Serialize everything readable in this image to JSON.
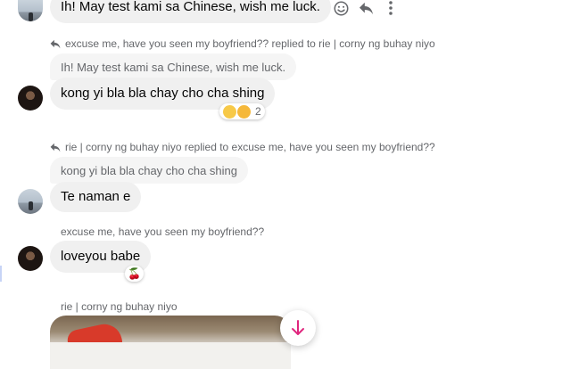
{
  "messages": {
    "m1": {
      "text": "Ih! May test kami sa Chinese, wish me luck."
    },
    "m2": {
      "reply_header": "excuse me, have you seen my boyfriend?? replied to rie | corny ng buhay niyo",
      "quoted": "Ih! May test kami sa Chinese, wish me luck.",
      "text": "kong yi bla bla chay cho cha shing",
      "reaction_count": "2"
    },
    "m3": {
      "reply_header": "rie | corny ng buhay niyo replied to excuse me, have you seen my boyfriend??",
      "quoted": "kong yi bla bla chay cho cha shing",
      "text": "Te naman e"
    },
    "m4": {
      "sender": "excuse me, have you seen my boyfriend??",
      "text": "loveyou babe",
      "reaction": "🍒"
    },
    "m5": {
      "sender": "rie | corny ng buhay niyo"
    }
  },
  "icons": [
    "smiley-icon",
    "reply-icon",
    "more-icon",
    "arrow-down-icon",
    "cherry-icon"
  ],
  "colors": {
    "bubble": "#f0f0f0",
    "meta": "#65676b",
    "accent": "#e0267e"
  }
}
